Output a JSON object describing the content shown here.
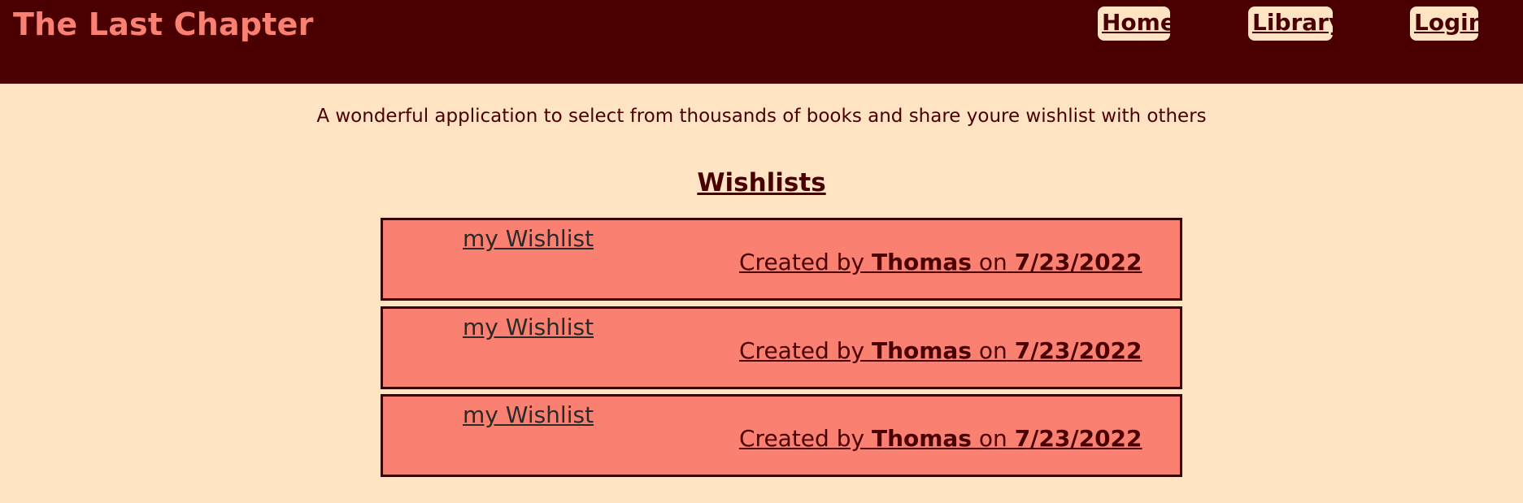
{
  "header": {
    "brand": "The Last Chapter",
    "nav": [
      {
        "label": "Home"
      },
      {
        "label": "Library"
      },
      {
        "label": "Login"
      }
    ]
  },
  "tagline": "A wonderful application to select from thousands of books and share youre wishlist with others",
  "section_title": "Wishlists",
  "wishlists": [
    {
      "name": "my Wishlist",
      "created_prefix": "Created by",
      "author": "Thomas",
      "on_word": "on",
      "date": "7/23/2022"
    },
    {
      "name": "my Wishlist",
      "created_prefix": "Created by",
      "author": "Thomas",
      "on_word": "on",
      "date": "7/23/2022"
    },
    {
      "name": "my Wishlist",
      "created_prefix": "Created by",
      "author": "Thomas",
      "on_word": "on",
      "date": "7/23/2022"
    }
  ],
  "colors": {
    "header_bg": "#4a0000",
    "brand": "#fa8072",
    "page_bg": "#ffe4c4",
    "card_bg": "#fa8072"
  }
}
